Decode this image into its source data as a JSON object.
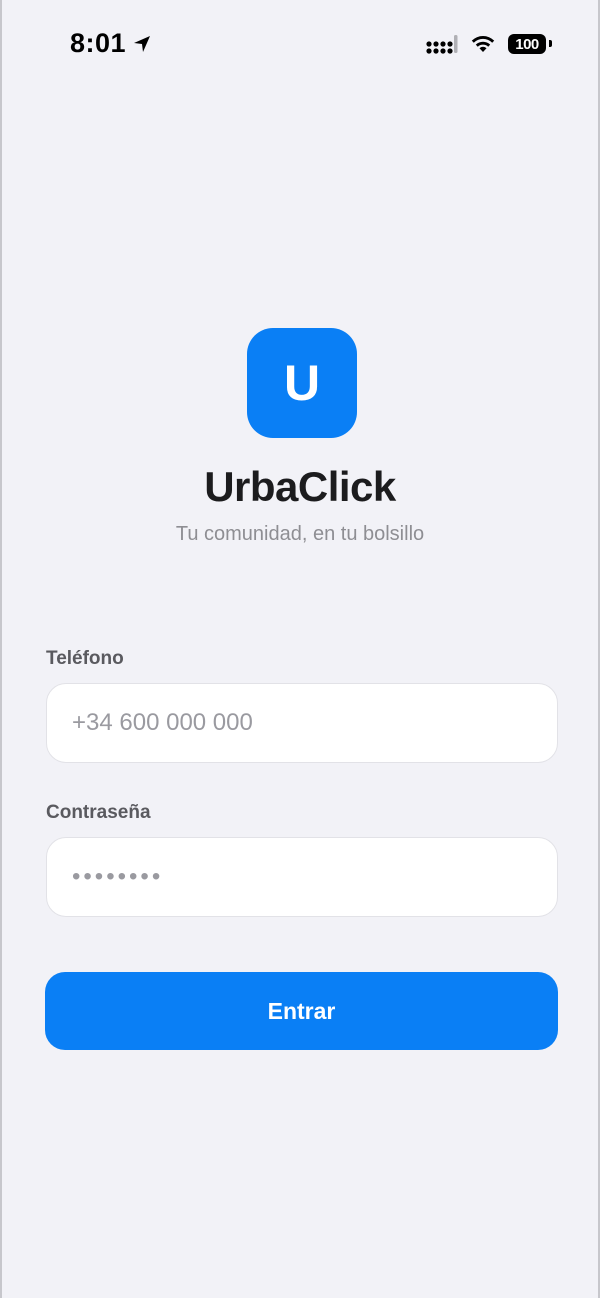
{
  "status_bar": {
    "time": "8:01",
    "battery_level": "100",
    "icons": [
      "location-arrow-icon",
      "cellular-signal-icon",
      "wifi-icon",
      "battery-icon"
    ]
  },
  "app": {
    "logo_letter": "U",
    "title": "UrbaClick",
    "subtitle": "Tu comunidad, en tu bolsillo"
  },
  "form": {
    "phone_label": "Teléfono",
    "phone_placeholder": "+34 600 000 000",
    "password_label": "Contraseña",
    "password_placeholder": "••••••••",
    "submit_label": "Entrar"
  },
  "colors": {
    "accent": "#0a7ff5",
    "background": "#f2f2f7",
    "field_background": "#ffffff",
    "placeholder": "#9a9aa0",
    "subtitle": "#8e8e93"
  }
}
